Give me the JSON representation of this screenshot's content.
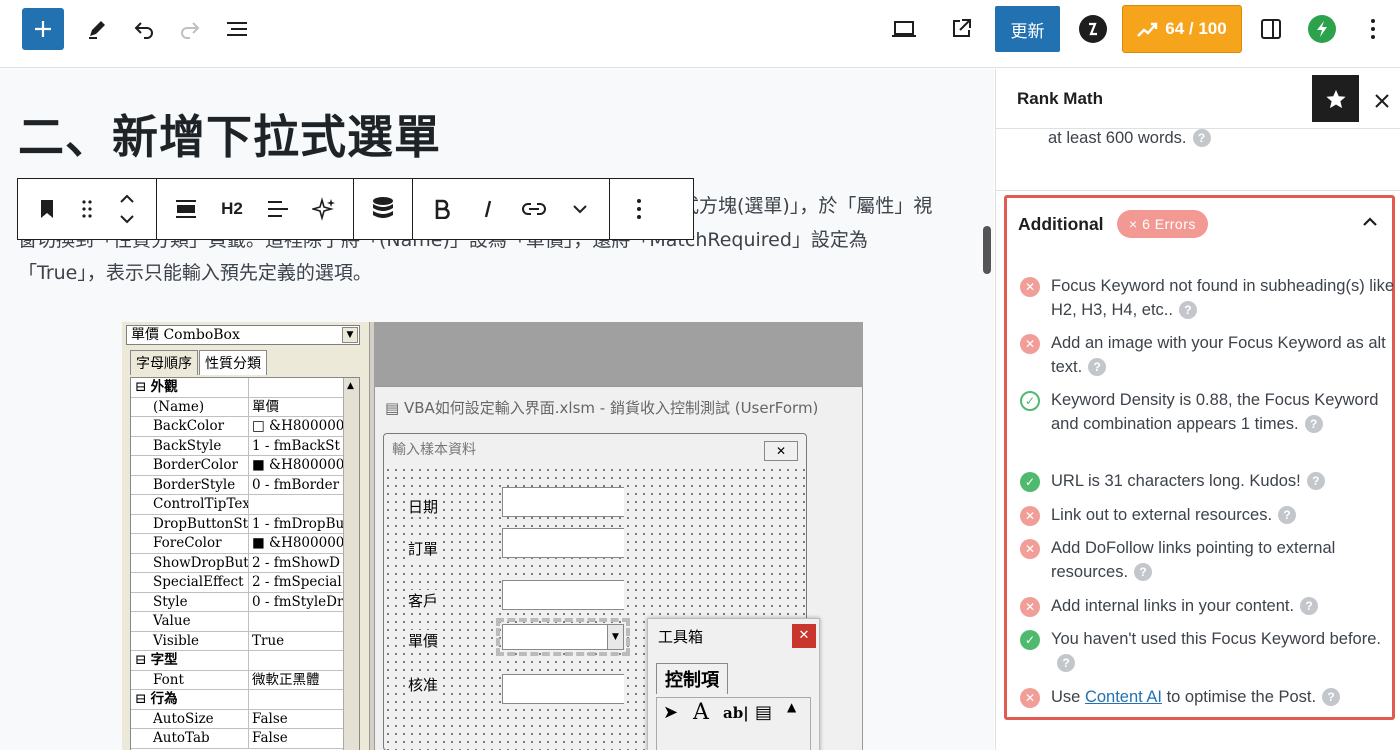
{
  "topbar": {
    "update_label": "更新",
    "score_label": "64 / 100",
    "accent_color": "#2271b1",
    "score_color": "#f7a41d",
    "icons": [
      "plus-icon",
      "pen-icon",
      "undo-icon",
      "redo-icon",
      "list-view-icon",
      "preview-icon",
      "external-link-icon",
      "brand-b-icon",
      "layout-icon",
      "bolt-icon"
    ]
  },
  "editor": {
    "title": "二、新增下拉式選單",
    "para_line1": "式方塊(選單)」，於「屬性」視",
    "para_line2": "窗切換到「性質分類」頁籤。這裡除了將「(Name)」設為「單價」，還將「MatchRequired」設定為",
    "para_line3": "「True」，表示只能輸入預先定義的選項。",
    "block_toolbar": {
      "heading_label": "H2"
    }
  },
  "vba": {
    "combo_label": "單價 ComboBox",
    "tabs": [
      "字母順序",
      "性質分類"
    ],
    "properties": [
      {
        "name": "外觀",
        "value": "",
        "cat": true
      },
      {
        "name": "(Name)",
        "value": "單價"
      },
      {
        "name": "BackColor",
        "value": "□ &H800000"
      },
      {
        "name": "BackStyle",
        "value": "1 - fmBackSt"
      },
      {
        "name": "BorderColor",
        "value": "■ &H800000"
      },
      {
        "name": "BorderStyle",
        "value": "0 - fmBorder"
      },
      {
        "name": "ControlTipTex",
        "value": ""
      },
      {
        "name": "DropButtonSty",
        "value": "1 - fmDropBu"
      },
      {
        "name": "ForeColor",
        "value": "■ &H800000"
      },
      {
        "name": "ShowDropButt",
        "value": "2 - fmShowD"
      },
      {
        "name": "SpecialEffect",
        "value": "2 - fmSpecial"
      },
      {
        "name": "Style",
        "value": "0 - fmStyleDr"
      },
      {
        "name": "Value",
        "value": ""
      },
      {
        "name": "Visible",
        "value": "True"
      },
      {
        "name": "字型",
        "value": "",
        "cat": true
      },
      {
        "name": "Font",
        "value": "微軟正黑體"
      },
      {
        "name": "行為",
        "value": "",
        "cat": true
      },
      {
        "name": "AutoSize",
        "value": "False"
      },
      {
        "name": "AutoTab",
        "value": "False"
      }
    ],
    "userform_title": "VBA如何設定輸入界面.xlsm - 銷貨收入控制測試 (UserForm)",
    "frame_title": "輸入樣本資料",
    "labels": [
      "日期",
      "訂單",
      "客戶",
      "單價",
      "核准"
    ],
    "toolbox_title": "工具箱",
    "toolbox_tab": "控制項"
  },
  "sidebar": {
    "title": "Rank Math",
    "prev_item": "at least 600 words.",
    "section_title": "Additional",
    "error_badge": "× 6 Errors",
    "checks": [
      {
        "status": "error",
        "text": "Focus Keyword not found in subheading(s) like H2, H3, H4, etc.."
      },
      {
        "status": "error",
        "text": "Add an image with your Focus Keyword as alt text."
      },
      {
        "status": "ok-outline",
        "text": "Keyword Density is 0.88, the Focus Keyword and combination appears 1 times."
      },
      {
        "status": "ok",
        "text": "URL is 31 characters long. Kudos!"
      },
      {
        "status": "error",
        "text": "Link out to external resources."
      },
      {
        "status": "error",
        "text": "Add DoFollow links pointing to external resources."
      },
      {
        "status": "error",
        "text": "Add internal links in your content."
      },
      {
        "status": "ok",
        "text": "You haven't used this Focus Keyword before."
      },
      {
        "status": "error",
        "text_before": "Use ",
        "link": "Content AI",
        "text_after": " to optimise the Post."
      }
    ],
    "error_color": "#e25b52",
    "ok_color": "#4fba6f"
  }
}
